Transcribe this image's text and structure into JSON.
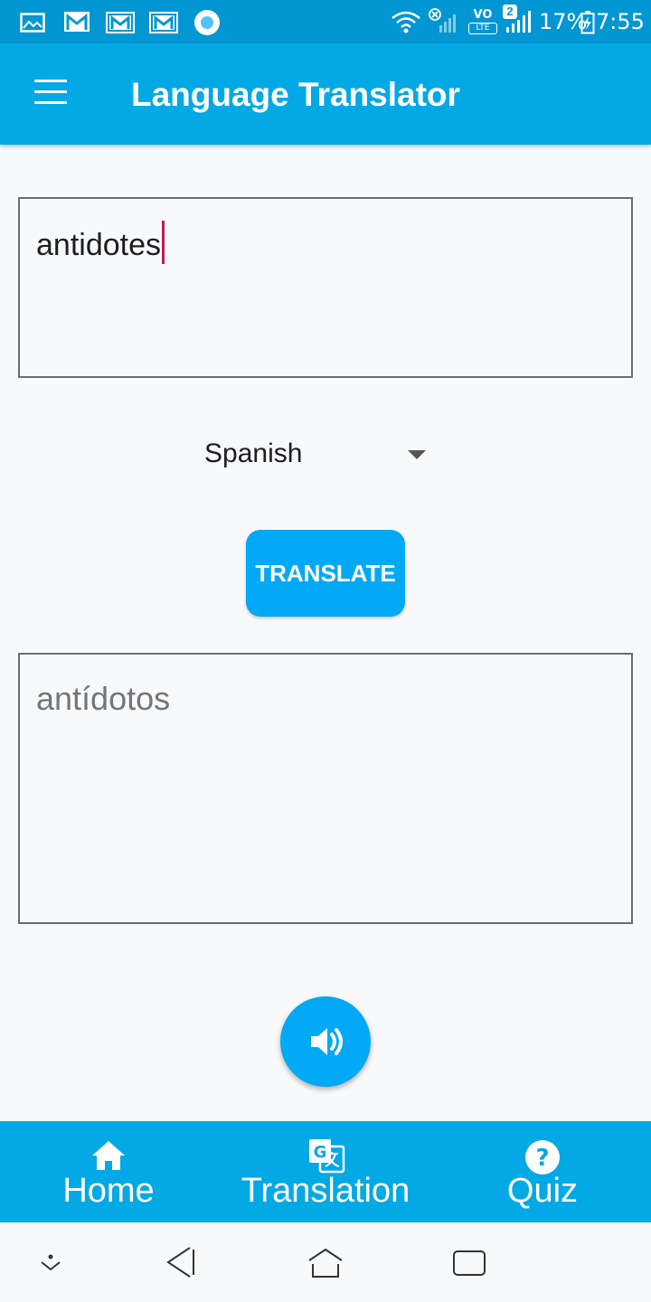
{
  "status_bar": {
    "battery": "17%",
    "time": "7:55",
    "sim_badge": "2",
    "volte_top": "VO",
    "volte_bottom": "LTE",
    "icons": [
      "gallery-icon",
      "gmail-icon",
      "gmail-icon",
      "gmail-icon",
      "circle-app-icon",
      "wifi-icon",
      "no-signal-icon",
      "volte-icon",
      "signal-icon",
      "battery-charging-icon"
    ]
  },
  "app_bar": {
    "title": "Language Translator",
    "menu_icon": "menu-icon"
  },
  "input": {
    "value": "antidotes"
  },
  "language_select": {
    "selected": "Spanish"
  },
  "translate_button": {
    "label": "TRANSLATE"
  },
  "output": {
    "value": "antídotos"
  },
  "speak_button": {
    "icon": "speaker-icon"
  },
  "bottom_nav": {
    "items": [
      {
        "label": "Home",
        "icon": "home-icon"
      },
      {
        "label": "Translation",
        "icon": "translate-icon"
      },
      {
        "label": "Quiz",
        "icon": "help-icon"
      }
    ]
  },
  "system_nav": {
    "icons": [
      "hide-keyboard-icon",
      "back-icon",
      "home-nav-icon",
      "recents-icon"
    ]
  },
  "colors": {
    "status_bar": "#0296d2",
    "app_bar": "#03a9e4",
    "accent": "#03a9f4",
    "caret": "#c2185b",
    "background": "#f8f9fa"
  }
}
